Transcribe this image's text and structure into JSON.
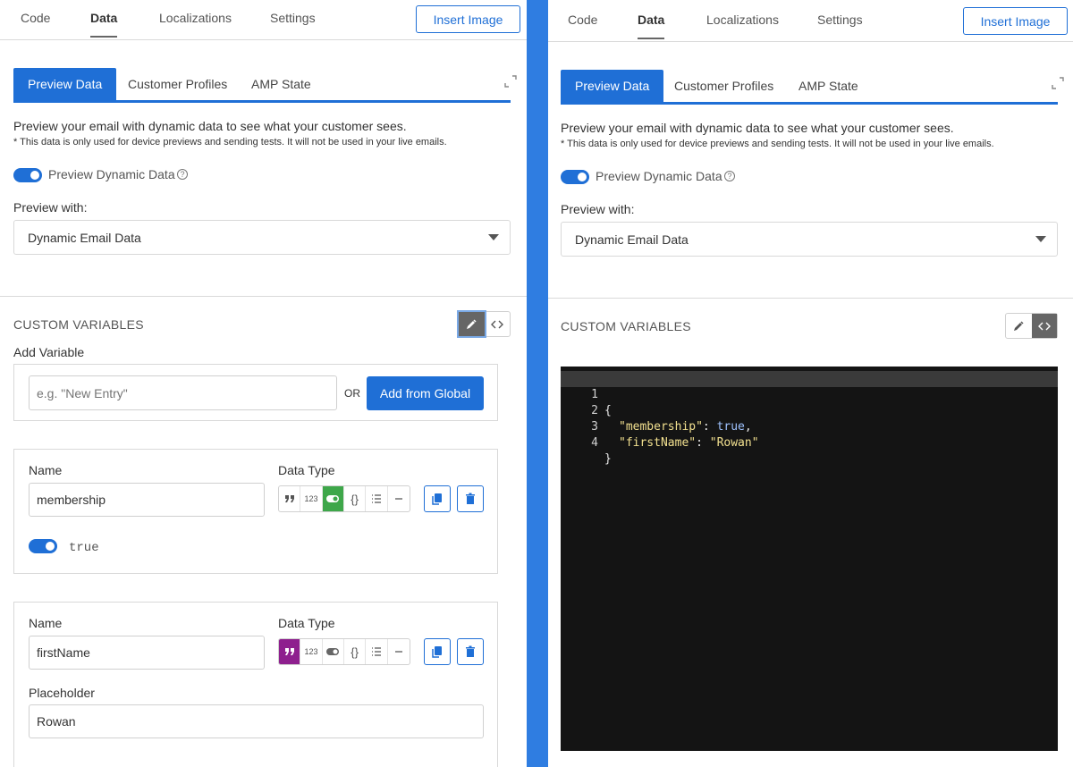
{
  "top_tabs": [
    "Code",
    "Data",
    "Localizations",
    "Settings"
  ],
  "active_top_tab": "Data",
  "insert_image_label": "Insert Image",
  "sub_tabs": [
    "Preview Data",
    "Customer Profiles",
    "AMP State"
  ],
  "active_sub_tab": "Preview Data",
  "intro_text": "Preview your email with dynamic data to see what your customer sees.",
  "note_text": "* This data is only used for device previews and sending tests. It will not be used in your live emails.",
  "preview_toggle_label": "Preview Dynamic Data",
  "preview_toggle_on": true,
  "preview_with_label": "Preview with:",
  "preview_with_value": "Dynamic Email Data",
  "custom_variables_title": "CUSTOM VARIABLES",
  "add_variable_label": "Add Variable",
  "new_entry_placeholder": "e.g. \"New Entry\"",
  "or_label": "OR",
  "add_from_global_label": "Add from Global",
  "name_label": "Name",
  "data_type_label": "Data Type",
  "placeholder_label": "Placeholder",
  "data_type_options": [
    "string",
    "number",
    "boolean",
    "object",
    "array",
    "null"
  ],
  "number_glyph": "123",
  "variables": [
    {
      "name": "membership",
      "type": "boolean",
      "value": "true",
      "toggle_on": true
    },
    {
      "name": "firstName",
      "type": "string",
      "placeholder_value": "Rowan"
    }
  ],
  "code_lines": [
    {
      "n": "1",
      "text": "{"
    },
    {
      "n": "2",
      "key": "\"membership\"",
      "sep": ": ",
      "value": "true",
      "value_type": "bool",
      "end": ","
    },
    {
      "n": "3",
      "key": "\"firstName\"",
      "sep": ": ",
      "value": "\"Rowan\"",
      "value_type": "str",
      "end": ""
    },
    {
      "n": "4",
      "text": "}"
    }
  ],
  "colors": {
    "accent": "#1f6fd6",
    "boolean_active": "#3ea74a",
    "string_active": "#8e1f8e",
    "editor_bg": "#141414",
    "divider": "#2f7de1"
  },
  "left_panel_mode": "edit",
  "right_panel_mode": "code"
}
